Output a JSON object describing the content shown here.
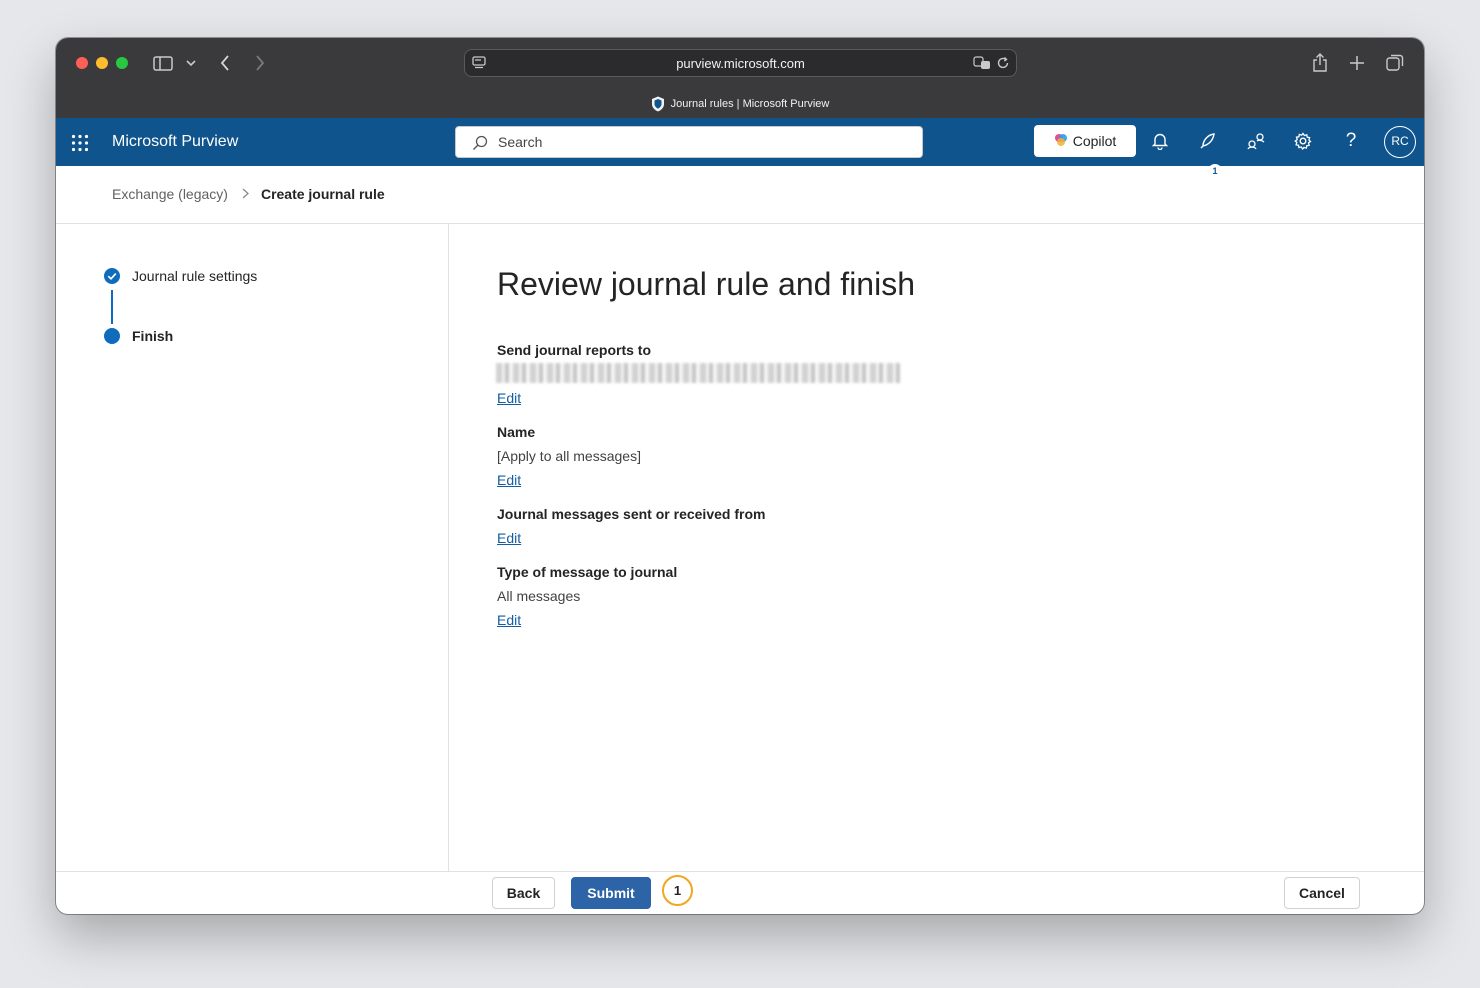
{
  "browser": {
    "url": "purview.microsoft.com",
    "tab_title": "Journal rules | Microsoft Purview"
  },
  "header": {
    "brand": "Microsoft Purview",
    "search_placeholder": "Search",
    "copilot_label": "Copilot",
    "notification_badge": "1",
    "avatar_initials": "RC",
    "help_label": "?"
  },
  "breadcrumb": {
    "parent": "Exchange (legacy)",
    "current": "Create journal rule"
  },
  "stepper": {
    "steps": [
      {
        "label": "Journal rule settings",
        "state": "completed"
      },
      {
        "label": "Finish",
        "state": "current"
      }
    ]
  },
  "main": {
    "title": "Review journal rule and finish",
    "sections": [
      {
        "label": "Send journal reports to",
        "value": "",
        "edit": "Edit"
      },
      {
        "label": "Name",
        "value": "[Apply to all messages]",
        "edit": "Edit"
      },
      {
        "label": "Journal messages sent or received from",
        "value": "",
        "edit": "Edit"
      },
      {
        "label": "Type of message to journal",
        "value": "All messages",
        "edit": "Edit"
      }
    ]
  },
  "footer": {
    "back": "Back",
    "submit": "Submit",
    "cancel": "Cancel",
    "step_marker": "1"
  },
  "colors": {
    "header_bg": "#0f548c",
    "accent": "#0f6cbd",
    "primary_button": "#2d63a7",
    "marker_ring": "#f3a61f"
  }
}
